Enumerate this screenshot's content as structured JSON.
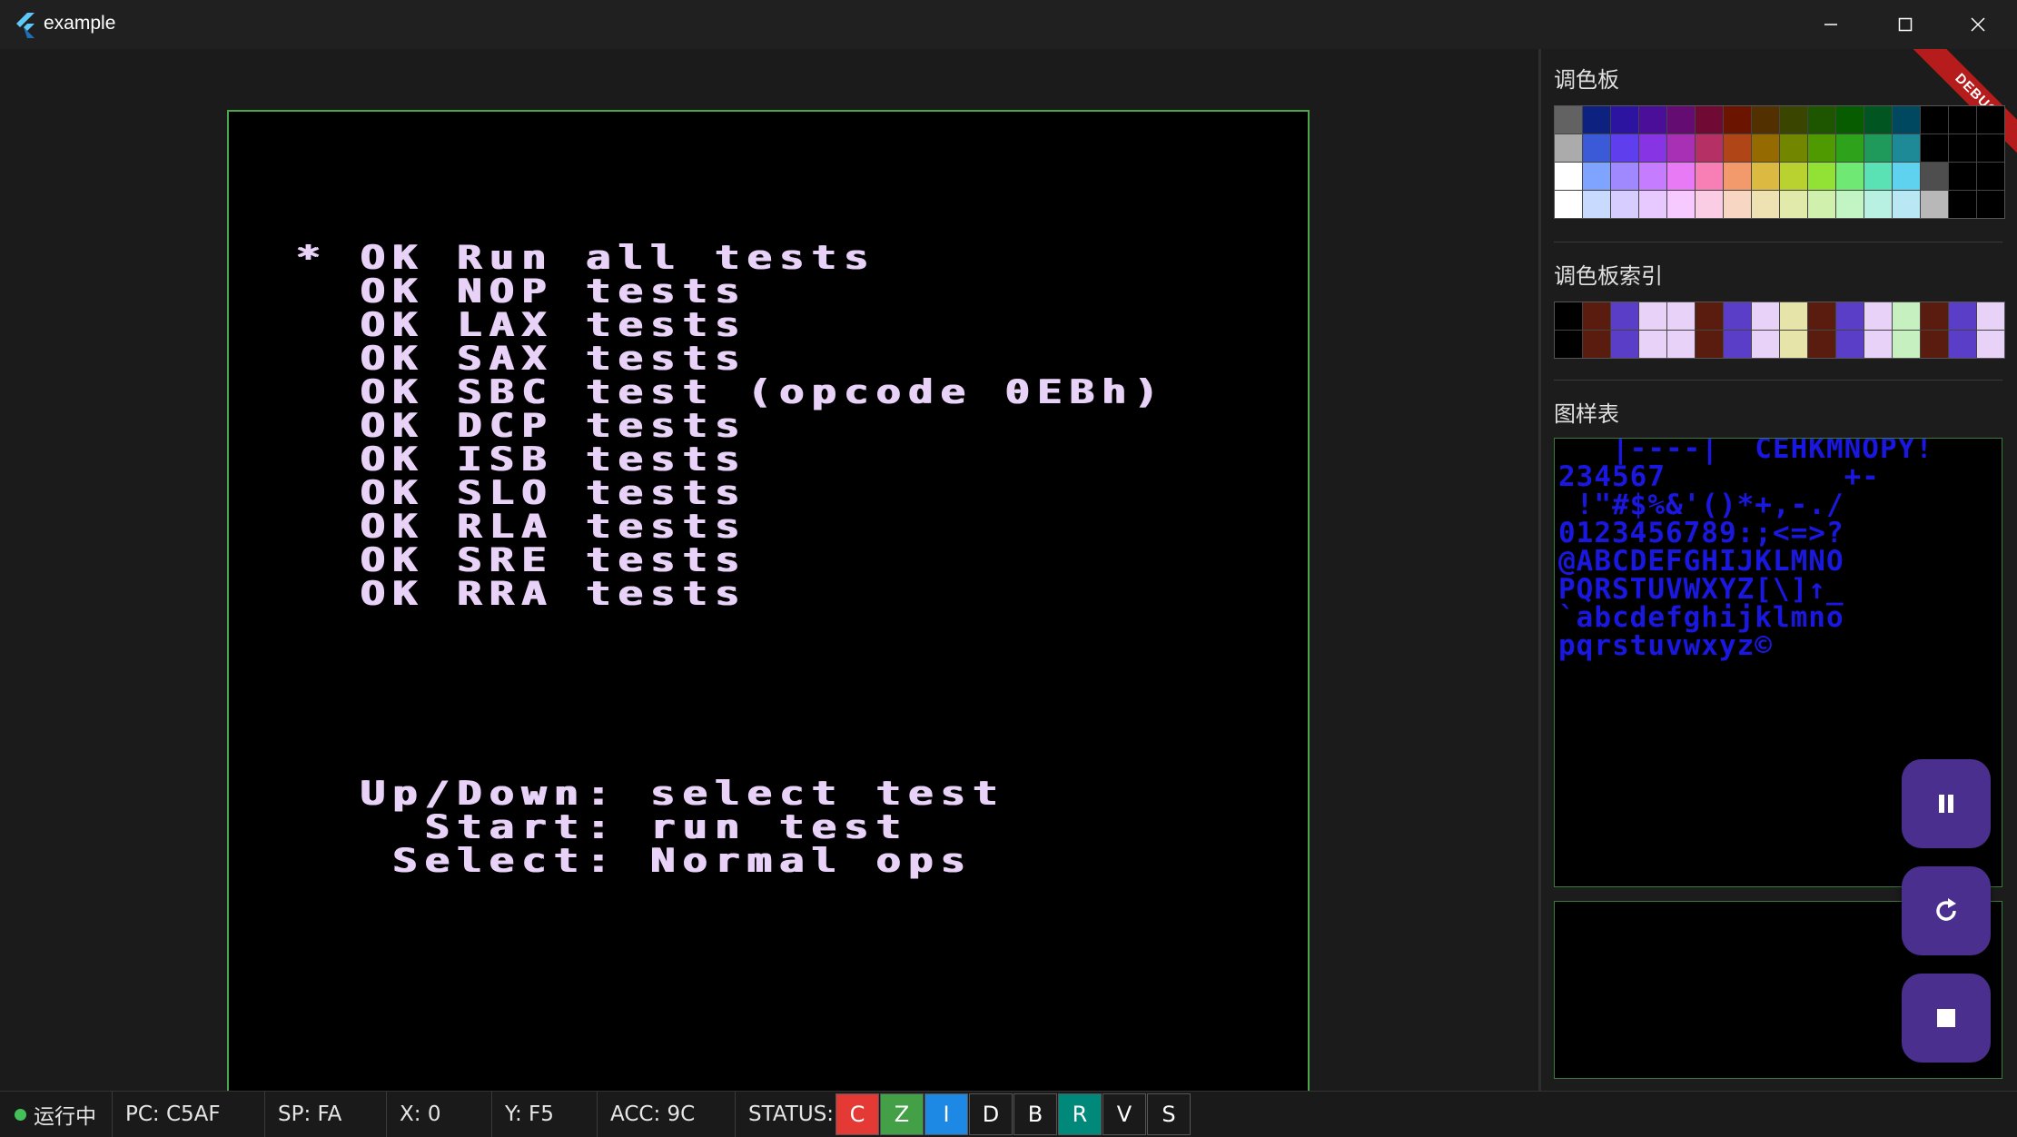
{
  "window": {
    "title": "example",
    "icons": {
      "logo": "flutter-logo-icon",
      "minimize": "minimize-icon",
      "maximize": "maximize-icon",
      "close": "close-icon"
    }
  },
  "screen": {
    "lines": [
      "* OK Run all tests",
      "  OK NOP tests",
      "  OK LAX tests",
      "  OK SAX tests",
      "  OK SBC test (opcode 0EBh)",
      "  OK DCP tests",
      "  OK ISB tests",
      "  OK SLO tests",
      "  OK RLA tests",
      "  OK SRE tests",
      "  OK RRA tests"
    ],
    "help": [
      "  Up/Down: select test",
      "    Start: run test",
      "   Select: Normal ops"
    ],
    "text_color": "#e8d2f8",
    "border_color": "#4aa84a"
  },
  "panel": {
    "palette_title": "调色板",
    "palette_index_title": "调色板索引",
    "pattern_title": "图样表",
    "debug_banner": "DEBUG",
    "palette": [
      [
        "#626262",
        "#0d2280",
        "#2c14a0",
        "#4b0e98",
        "#650c72",
        "#700a34",
        "#6b1500",
        "#523000",
        "#3a4600",
        "#1e5600",
        "#085c00",
        "#005520",
        "#004860",
        "#000000",
        "#000000",
        "#000000"
      ],
      [
        "#ababab",
        "#3b5ad8",
        "#5f3eee",
        "#8634e4",
        "#a730b4",
        "#b53064",
        "#b04618",
        "#956a00",
        "#738600",
        "#4e9a00",
        "#2ea21a",
        "#1f9a5a",
        "#1e8a98",
        "#000000",
        "#000000",
        "#000000"
      ],
      [
        "#ffffff",
        "#7ea4ff",
        "#a089ff",
        "#c67cff",
        "#e87bf5",
        "#f77fb6",
        "#f29a6b",
        "#dcb940",
        "#b9d230",
        "#91e234",
        "#70e874",
        "#5ae2b4",
        "#5ed2ee",
        "#4e4e4e",
        "#000000",
        "#000000"
      ],
      [
        "#ffffff",
        "#c8dbff",
        "#d7cdff",
        "#e8c9ff",
        "#f6caff",
        "#fbcde4",
        "#f8d6c4",
        "#efe2b2",
        "#e1eaaa",
        "#d0f0ae",
        "#c2f4c4",
        "#b8f1e2",
        "#b9e8f4",
        "#b8b8b8",
        "#000000",
        "#000000"
      ]
    ],
    "palette_index": [
      [
        "#000000",
        "#5a1c0e",
        "#5a3ec8",
        "#e8d2f8",
        "#e8d2f8",
        "#5a1c0e",
        "#5a3ec8",
        "#e8d2f8",
        "#e6e4a8",
        "#5a1c0e",
        "#5a3ec8",
        "#e8d2f8",
        "#c6f0c0",
        "#5a1c0e",
        "#5a3ec8",
        "#e8d2f8"
      ],
      [
        "#000000",
        "#5a1c0e",
        "#5a3ec8",
        "#e8d2f8",
        "#e8d2f8",
        "#5a1c0e",
        "#5a3ec8",
        "#e8d2f8",
        "#e6e4a8",
        "#5a1c0e",
        "#5a3ec8",
        "#e8d2f8",
        "#c6f0c0",
        "#5a1c0e",
        "#5a3ec8",
        "#e8d2f8"
      ]
    ],
    "pattern_lines": [
      "   |----|  CEHKMNOPY!",
      "234567          +-",
      " !\"#$%&'()*+,-./",
      "0123456789:;<=>?",
      "@ABCDEFGHIJKLMNO",
      "PQRSTUVWXYZ[\\]↑_",
      "`abcdefghijklmno",
      "pqrstuvwxyz©"
    ],
    "pattern_color": "#1a18e0"
  },
  "fabs": {
    "pause": "pause-icon",
    "restart": "restart-icon",
    "stop": "stop-icon"
  },
  "status": {
    "running": "运行中",
    "pc": "PC: C5AF",
    "sp": "SP: FA",
    "x": "X: 0",
    "y": "Y: F5",
    "acc": "ACC: 9C",
    "status_label": "STATUS:",
    "flags": [
      {
        "label": "C",
        "color": "#e53935"
      },
      {
        "label": "Z",
        "color": "#43a047"
      },
      {
        "label": "I",
        "color": "#1e88e5"
      },
      {
        "label": "D",
        "color": "#1a1a1a"
      },
      {
        "label": "B",
        "color": "#1a1a1a"
      },
      {
        "label": "R",
        "color": "#00897b"
      },
      {
        "label": "V",
        "color": "#1a1a1a"
      },
      {
        "label": "S",
        "color": "#1a1a1a"
      }
    ],
    "running_color": "#43c059"
  }
}
